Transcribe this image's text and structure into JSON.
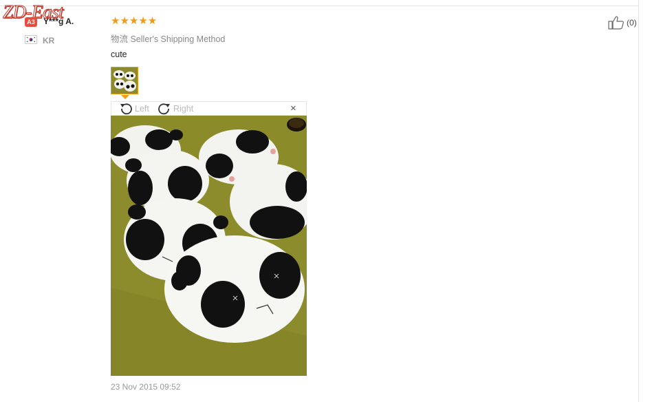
{
  "watermark": "ZD-East",
  "reviewer": {
    "level_badge": "A3",
    "name": "Y***g A.",
    "country": "KR",
    "flag_icon": "korea-flag-icon"
  },
  "review": {
    "rating": 5,
    "stars": "★★★★★",
    "star_color": "#f29a17",
    "shipping_method": "物流 Seller's Shipping Method",
    "text": "cute",
    "date": "23 Nov 2015 09:52"
  },
  "helpful": {
    "icon": "thumbs-up-icon",
    "count_label": "(0)"
  },
  "viewer": {
    "rotate_left_label": "Left",
    "rotate_right_label": "Right",
    "close_label": "×",
    "accent_color": "#f39c12"
  }
}
